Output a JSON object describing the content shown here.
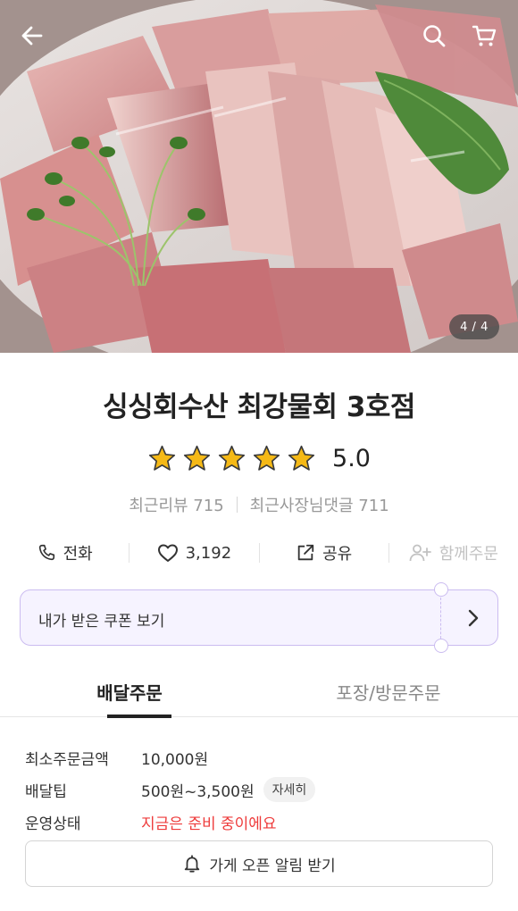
{
  "hero": {
    "page_counter": "4 / 4",
    "icons": {
      "back": "arrow-left-icon",
      "search": "search-icon",
      "cart": "cart-icon"
    }
  },
  "store": {
    "name": "싱싱회수산 최강물회 3호점",
    "rating": 5.0,
    "rating_text": "5.0",
    "stars": 5,
    "recent_reviews_label": "최근리뷰 715",
    "owner_comments_label": "최근사장님댓글 711"
  },
  "actions": {
    "call_label": "전화",
    "likes_count": "3,192",
    "share_label": "공유",
    "group_order_label": "함께주문"
  },
  "coupon": {
    "label": "내가 받은 쿠폰 보기"
  },
  "tabs": [
    {
      "label": "배달주문",
      "active": true
    },
    {
      "label": "포장/방문주문",
      "active": false
    }
  ],
  "delivery_info": {
    "min_order_label": "최소주문금액",
    "min_order_value": "10,000원",
    "tip_label": "배달팁",
    "tip_value": "500원~3,500원",
    "tip_detail_button": "자세히",
    "status_label": "운영상태",
    "status_value": "지금은 준비 중이에요"
  },
  "alarm_button": {
    "label": "가게 오픈 알림 받기"
  },
  "colors": {
    "star": "#f5b916",
    "coupon_border": "#cbbcf0",
    "coupon_bg": "#f6f3ff",
    "status_red": "#ee3b3b"
  }
}
